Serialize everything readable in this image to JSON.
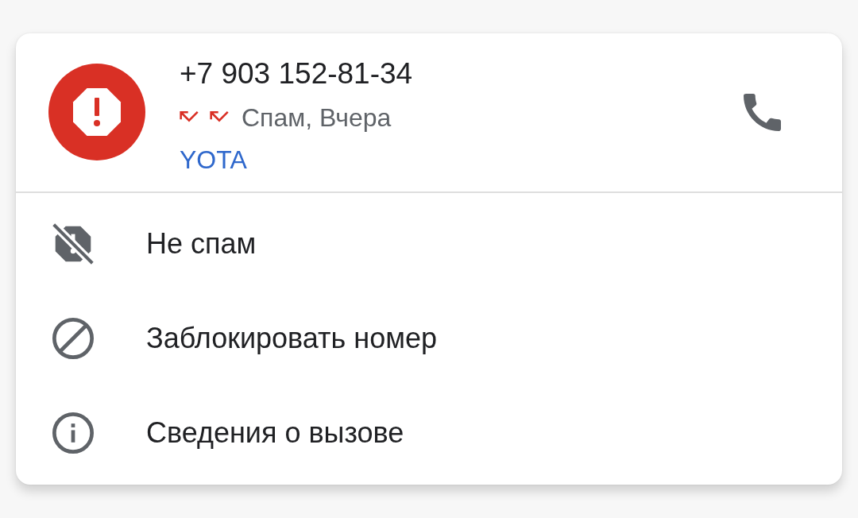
{
  "call_log_entry": {
    "avatar": {
      "kind": "spam"
    },
    "number": "+7 903 152-81-34",
    "call_types": [
      {
        "kind": "missed"
      },
      {
        "kind": "missed"
      }
    ],
    "status": "Спам, Вчера",
    "carrier": "YOTA"
  },
  "menu": {
    "items": [
      {
        "kind": "not_spam",
        "label": "Не спам"
      },
      {
        "kind": "block",
        "label": "Заблокировать номер"
      },
      {
        "kind": "info",
        "label": "Сведения о вызове"
      }
    ]
  }
}
